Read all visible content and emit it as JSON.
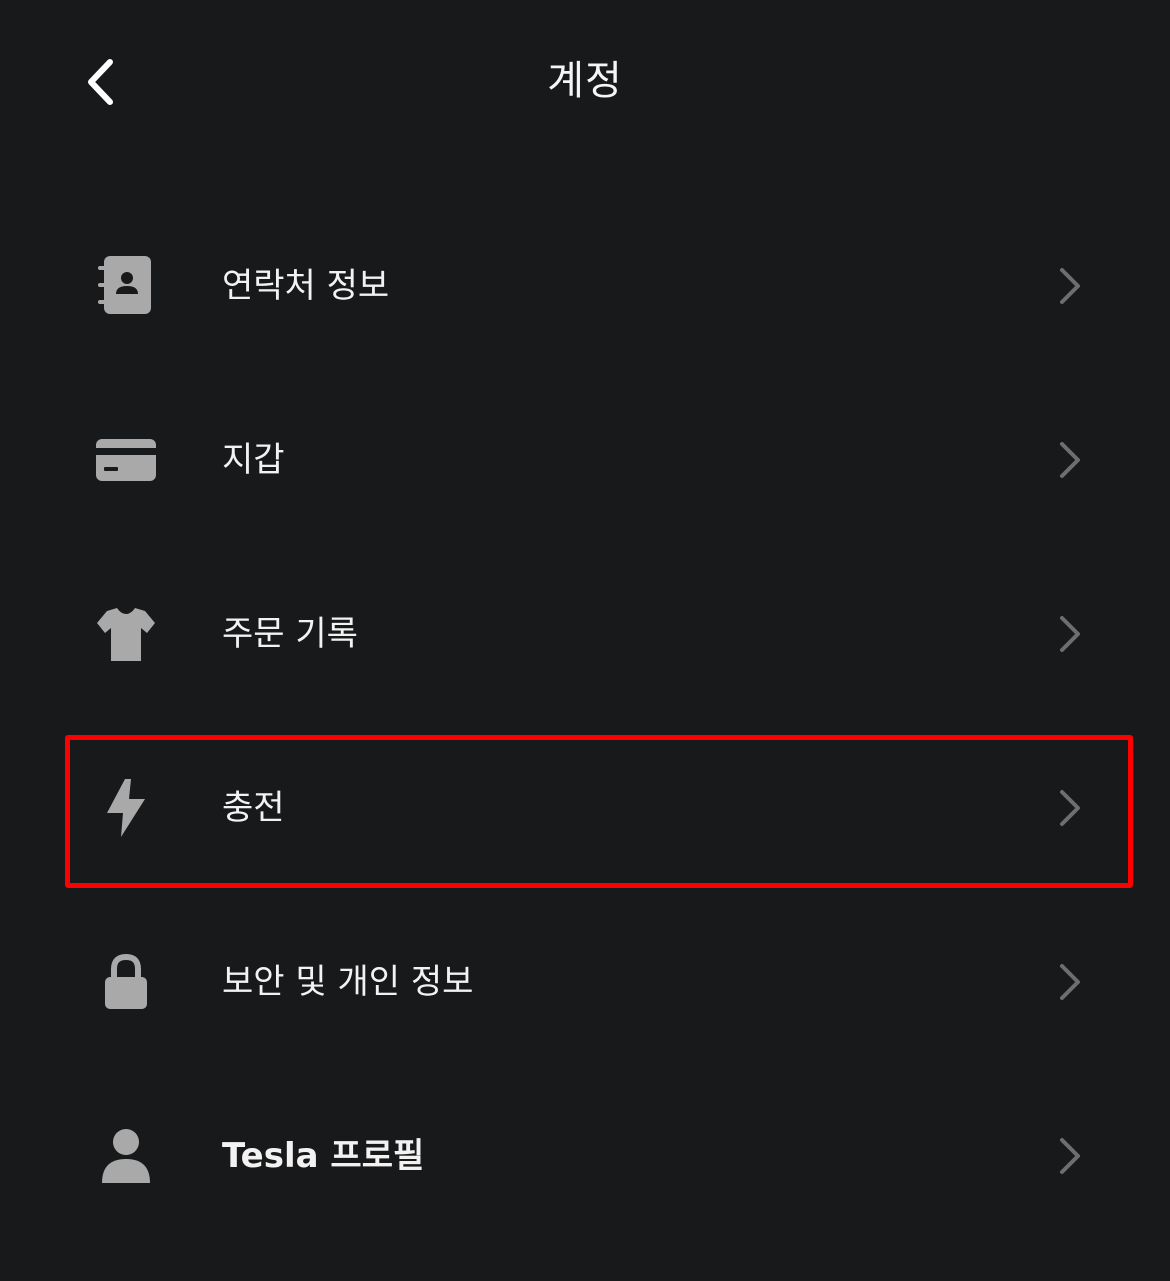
{
  "header": {
    "title": "계정",
    "back_icon": "chevron-left-icon"
  },
  "menu": {
    "items": [
      {
        "label": "연락처 정보",
        "icon": "contact-book-icon"
      },
      {
        "label": "지갑",
        "icon": "credit-card-icon"
      },
      {
        "label": "주문 기록",
        "icon": "tshirt-icon"
      },
      {
        "label": "충전",
        "icon": "lightning-bolt-icon",
        "highlighted": true
      },
      {
        "label": "보안 및 개인 정보",
        "icon": "lock-icon"
      },
      {
        "label": "Tesla 프로필",
        "icon": "person-icon"
      }
    ]
  },
  "colors": {
    "background": "#18191b",
    "text": "#f2f2f2",
    "icon": "#a9a9a9",
    "chevron": "#6e6e70",
    "highlight": "#ff0000"
  }
}
